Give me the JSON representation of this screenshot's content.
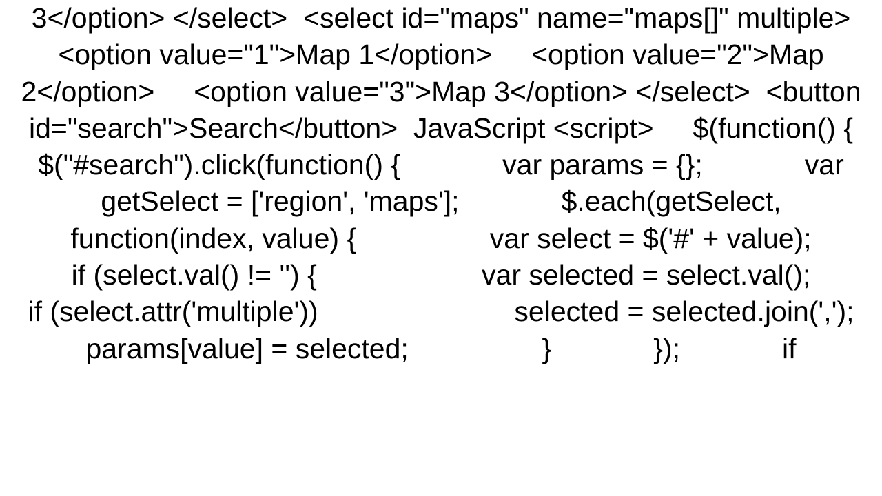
{
  "code_text": "3</option> </select>  <select id=\"maps\" name=\"maps[]\" multiple>     <option value=\"1\">Map 1</option>     <option value=\"2\">Map 2</option>     <option value=\"3\">Map 3</option> </select>  <button id=\"search\">Search</button>  JavaScript <script>     $(function() {         $(\"#search\").click(function() {             var params = {};             var getSelect = ['region', 'maps'];             $.each(getSelect, function(index, value) {                 var select = $('#' + value);                 if (select.val() != '') {                     var selected = select.val();                     if (select.attr('multiple'))                         selected = selected.join(',');                     params[value] = selected;                 }             });             if"
}
